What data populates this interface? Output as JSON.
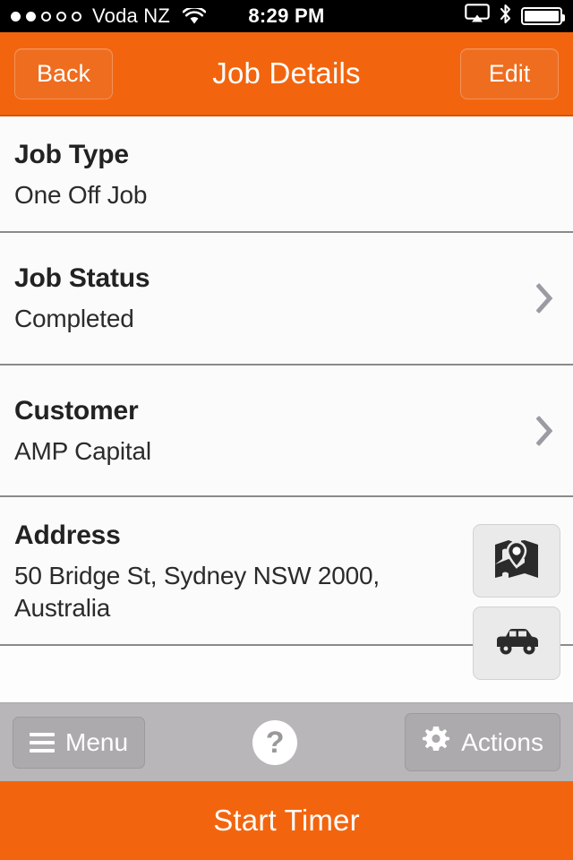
{
  "statusbar": {
    "signal_dots_filled": 2,
    "signal_dots_total": 5,
    "carrier": "Voda NZ",
    "wifi_icon": "wifi-icon",
    "time": "8:29 PM",
    "airplay_icon": "airplay-icon",
    "bluetooth_icon": "bluetooth-icon",
    "battery_icon": "battery-icon",
    "battery_level": 100
  },
  "navbar": {
    "back_label": "Back",
    "title": "Job Details",
    "edit_label": "Edit",
    "background_color": "#f2650e"
  },
  "rows": [
    {
      "label": "Job Type",
      "value": "One Off Job",
      "has_chevron": false
    },
    {
      "label": "Job Status",
      "value": "Completed",
      "has_chevron": true
    },
    {
      "label": "Customer",
      "value": "AMP Capital",
      "has_chevron": true
    },
    {
      "label": "Address",
      "value": "50 Bridge St, Sydney NSW 2000, Australia",
      "has_chevron": false
    }
  ],
  "address_actions": {
    "map_icon": "map-pin-icon",
    "directions_icon": "car-icon"
  },
  "toolbar": {
    "menu_label": "Menu",
    "menu_icon": "hamburger-icon",
    "help_label": "?",
    "help_icon": "question-mark-icon",
    "actions_label": "Actions",
    "actions_icon": "gear-icon",
    "background_color": "#b9b6b9"
  },
  "footer": {
    "start_timer_label": "Start Timer",
    "background_color": "#f2650e"
  }
}
